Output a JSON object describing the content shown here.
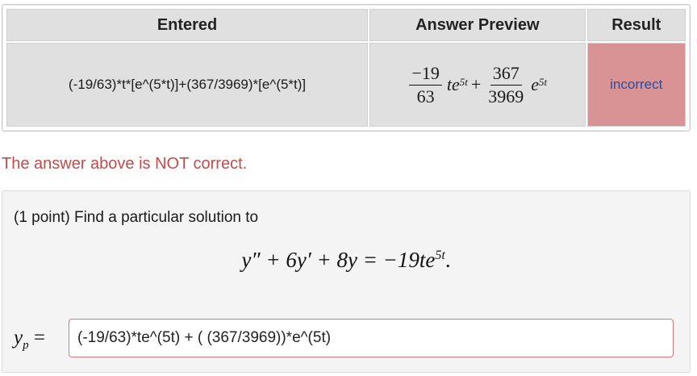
{
  "table": {
    "headers": {
      "entered": "Entered",
      "preview": "Answer Preview",
      "result": "Result"
    },
    "row": {
      "entered": "(-19/63)*t*[e^(5*t)]+(367/3969)*[e^(5*t)]",
      "preview": {
        "frac1_num": "−19",
        "frac1_den": "63",
        "term1_var": "te",
        "term1_exp": "5t",
        "plus": "+",
        "frac2_num": "367",
        "frac2_den": "3969",
        "term2_var": "e",
        "term2_exp": "5t"
      },
      "result": "incorrect"
    }
  },
  "message": "The answer above is NOT correct.",
  "problem": {
    "prompt": "(1 point) Find a particular solution to",
    "equation_lhs": "y″ + 6y′ + 8y = −19te",
    "equation_exp": "5t",
    "equation_end": ".",
    "answer_label_var": "y",
    "answer_label_sub": "p",
    "answer_label_eq": " =",
    "answer_value": "(-19/63)*te^(5t) + ( (367/3969))*e^(5t)"
  },
  "colors": {
    "incorrect_bg": "#d99395",
    "incorrect_text": "#1f4fa8",
    "error_message": "#c54a4a",
    "input_border": "#d97779"
  }
}
